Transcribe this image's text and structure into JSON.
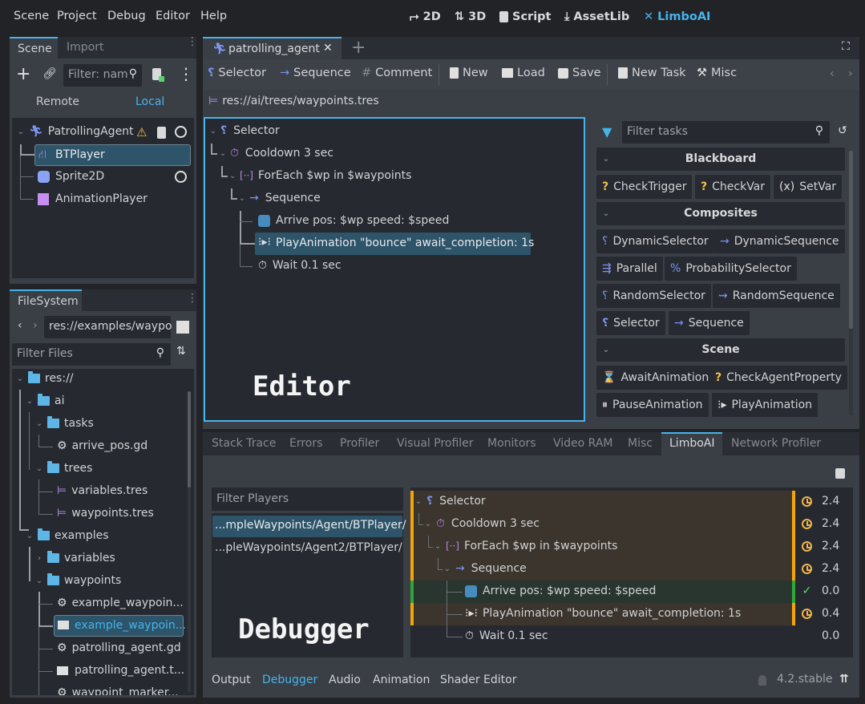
{
  "menu": [
    "Scene",
    "Project",
    "Debug",
    "Editor",
    "Help"
  ],
  "workspaces": [
    {
      "label": "2D",
      "icon": "2d-icon"
    },
    {
      "label": "3D",
      "icon": "3d-icon"
    },
    {
      "label": "Script",
      "icon": "script-icon"
    },
    {
      "label": "AssetLib",
      "icon": "download-icon"
    },
    {
      "label": "LimboAI",
      "icon": "limboai-icon",
      "active": true
    }
  ],
  "scene_dock": {
    "tabs": [
      "Scene",
      "Import"
    ],
    "filter_placeholder": "Filter: nam",
    "remote_label": "Remote",
    "local_label": "Local",
    "nodes": [
      {
        "name": "PatrollingAgent",
        "icon": "agent-icon",
        "warning": true,
        "script": true,
        "visible": true
      },
      {
        "name": "BTPlayer",
        "icon": "bt-player-icon",
        "selected": true
      },
      {
        "name": "Sprite2D",
        "icon": "sprite-icon",
        "visible": true
      },
      {
        "name": "AnimationPlayer",
        "icon": "animation-player-icon"
      }
    ]
  },
  "filesystem": {
    "tab": "FileSystem",
    "path": "res://examples/waypo",
    "filter_placeholder": "Filter Files",
    "items": [
      {
        "name": "res://",
        "type": "folder",
        "depth": 0,
        "expanded": true
      },
      {
        "name": "ai",
        "type": "folder",
        "depth": 1,
        "expanded": true
      },
      {
        "name": "tasks",
        "type": "folder",
        "depth": 2,
        "expanded": true
      },
      {
        "name": "arrive_pos.gd",
        "type": "script",
        "depth": 3
      },
      {
        "name": "trees",
        "type": "folder",
        "depth": 2,
        "expanded": true
      },
      {
        "name": "variables.tres",
        "type": "tree",
        "depth": 3
      },
      {
        "name": "waypoints.tres",
        "type": "tree",
        "depth": 3
      },
      {
        "name": "examples",
        "type": "folder",
        "depth": 1,
        "expanded": true
      },
      {
        "name": "variables",
        "type": "folder",
        "depth": 2,
        "expanded": false
      },
      {
        "name": "waypoints",
        "type": "folder",
        "depth": 2,
        "expanded": true
      },
      {
        "name": "example_waypoin...",
        "type": "script",
        "depth": 3
      },
      {
        "name": "example_waypoin...",
        "type": "scene",
        "depth": 3,
        "selected": true
      },
      {
        "name": "patrolling_agent.gd",
        "type": "script",
        "depth": 3
      },
      {
        "name": "patrolling_agent.t...",
        "type": "scene",
        "depth": 3
      },
      {
        "name": "waypoint_marker...",
        "type": "script",
        "depth": 3
      }
    ]
  },
  "editor": {
    "tab_title": "patrolling_agent",
    "toolbar": {
      "selector": "Selector",
      "sequence": "Sequence",
      "comment": "Comment",
      "new": "New",
      "load": "Load",
      "save": "Save",
      "new_task": "New Task",
      "misc": "Misc"
    },
    "resource_path": "res://ai/trees/waypoints.tres",
    "tree": [
      {
        "label": "Selector",
        "icon": "selector-icon",
        "depth": 0
      },
      {
        "label": "Cooldown 3 sec",
        "icon": "cooldown-icon",
        "depth": 1
      },
      {
        "label": "ForEach $wp in $waypoints",
        "icon": "foreach-icon",
        "depth": 2
      },
      {
        "label": "Sequence",
        "icon": "sequence-icon",
        "depth": 3
      },
      {
        "label": "Arrive  pos: $wp  speed: $speed",
        "icon": "godot-icon",
        "depth": 4
      },
      {
        "label": "PlayAnimation \"bounce\"  await_completion: 1s",
        "icon": "play-animation-icon",
        "depth": 4,
        "selected": true
      },
      {
        "label": "Wait 0.1 sec",
        "icon": "wait-icon",
        "depth": 4
      }
    ],
    "overlay_label": "Editor"
  },
  "task_palette": {
    "filter_placeholder": "Filter tasks",
    "categories": [
      {
        "name": "Blackboard",
        "tasks": [
          "CheckTrigger",
          "CheckVar",
          "SetVar"
        ]
      },
      {
        "name": "Composites",
        "tasks": [
          "DynamicSelector",
          "DynamicSequence",
          "Parallel",
          "ProbabilitySelector",
          "RandomSelector",
          "RandomSequence",
          "Selector",
          "Sequence"
        ]
      },
      {
        "name": "Scene",
        "tasks": [
          "AwaitAnimation",
          "CheckAgentProperty",
          "PauseAnimation",
          "PlayAnimation"
        ]
      }
    ]
  },
  "debugger": {
    "tabs": [
      "Stack Trace",
      "Errors",
      "Profiler",
      "Visual Profiler",
      "Monitors",
      "Video RAM",
      "Misc",
      "LimboAI",
      "Network Profiler"
    ],
    "active_tab": "LimboAI",
    "filter_players_placeholder": "Filter Players",
    "players": [
      {
        "path": "...mpleWaypoints/Agent/BTPlayer/",
        "selected": true
      },
      {
        "path": "...pleWaypoints/Agent2/BTPlayer/"
      }
    ],
    "tree": [
      {
        "label": "Selector",
        "status": "running",
        "time": "2.4"
      },
      {
        "label": "Cooldown 3 sec",
        "status": "running",
        "time": "2.4"
      },
      {
        "label": "ForEach $wp in $waypoints",
        "status": "running",
        "time": "2.4"
      },
      {
        "label": "Sequence",
        "status": "running",
        "time": "2.4"
      },
      {
        "label": "Arrive  pos: $wp  speed: $speed",
        "status": "success",
        "time": "0.0"
      },
      {
        "label": "PlayAnimation \"bounce\"  await_completion: 1s",
        "status": "running",
        "time": "0.4"
      },
      {
        "label": "Wait 0.1 sec",
        "status": "fresh",
        "time": "0.0"
      }
    ],
    "overlay_label": "Debugger"
  },
  "bottom_tabs": [
    "Output",
    "Debugger",
    "Audio",
    "Animation",
    "Shader Editor"
  ],
  "active_bottom_tab": "Debugger",
  "version": "4.2.stable",
  "colors": {
    "accent": "#45b4ec",
    "running": "#f5a30a",
    "success": "#2fa836",
    "selection": "#2d5469"
  }
}
